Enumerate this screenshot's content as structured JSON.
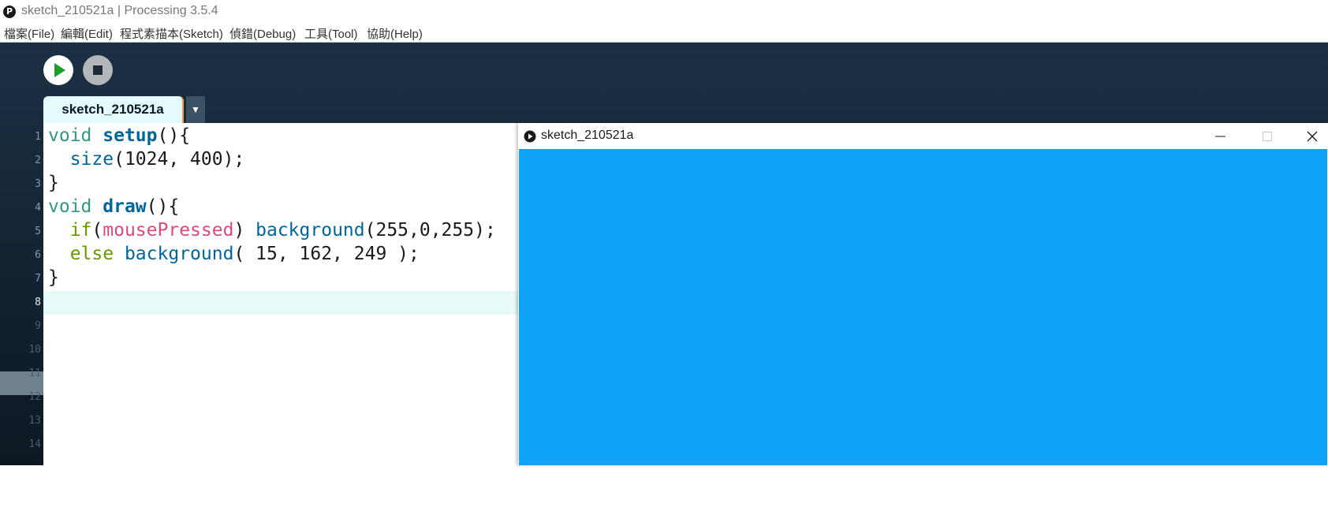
{
  "window": {
    "title": "sketch_210521a | Processing 3.5.4",
    "app_icon_glyph": "P"
  },
  "menu": {
    "items": [
      "檔案(File)",
      "編輯(Edit)",
      "程式素描本(Sketch)",
      "偵錯(Debug)",
      "工具(Tool)",
      "協助(Help)"
    ]
  },
  "toolbar": {
    "run_icon": "play-icon",
    "stop_icon": "stop-icon",
    "run_color": "#1f9c2a"
  },
  "tabs": {
    "active_label": "sketch_210521a",
    "menu_glyph": "▼"
  },
  "editor": {
    "line_numbers": [
      "1",
      "2",
      "3",
      "4",
      "5",
      "6",
      "7",
      "8",
      "9",
      "10",
      "11",
      "12",
      "13",
      "14"
    ],
    "current_line": "8",
    "lines": [
      {
        "indent": "",
        "tokens": [
          [
            "kw-type",
            "void"
          ],
          [
            "",
            " "
          ],
          [
            "kw-func",
            "setup"
          ],
          [
            "",
            "(){"
          ]
        ]
      },
      {
        "indent": "  ",
        "tokens": [
          [
            "kw-builtin",
            "size"
          ],
          [
            "",
            "(1024, 400);"
          ]
        ]
      },
      {
        "indent": "",
        "tokens": [
          [
            "",
            "}"
          ]
        ]
      },
      {
        "indent": "",
        "tokens": [
          [
            "kw-type",
            "void"
          ],
          [
            "",
            " "
          ],
          [
            "kw-func",
            "draw"
          ],
          [
            "",
            "(){"
          ]
        ]
      },
      {
        "indent": "  ",
        "tokens": [
          [
            "kw-ctrl",
            "if"
          ],
          [
            "",
            "("
          ],
          [
            "kw-var",
            "mousePressed"
          ],
          [
            "",
            ") "
          ],
          [
            "kw-builtin",
            "background"
          ],
          [
            "",
            "(255,0,255);"
          ]
        ]
      },
      {
        "indent": "  ",
        "tokens": [
          [
            "kw-ctrl",
            "else"
          ],
          [
            "",
            " "
          ],
          [
            "kw-builtin",
            "background"
          ],
          [
            "",
            "( 15, 162, 249 );"
          ]
        ]
      },
      {
        "indent": "",
        "tokens": [
          [
            "",
            "}"
          ]
        ]
      }
    ]
  },
  "sketch_window": {
    "title": "sketch_210521a",
    "icon": "play-circle-icon",
    "minimize_icon": "minimize-icon",
    "maximize_icon": "maximize-icon",
    "close_icon": "close-icon",
    "canvas_color": "#0fa2f9"
  }
}
